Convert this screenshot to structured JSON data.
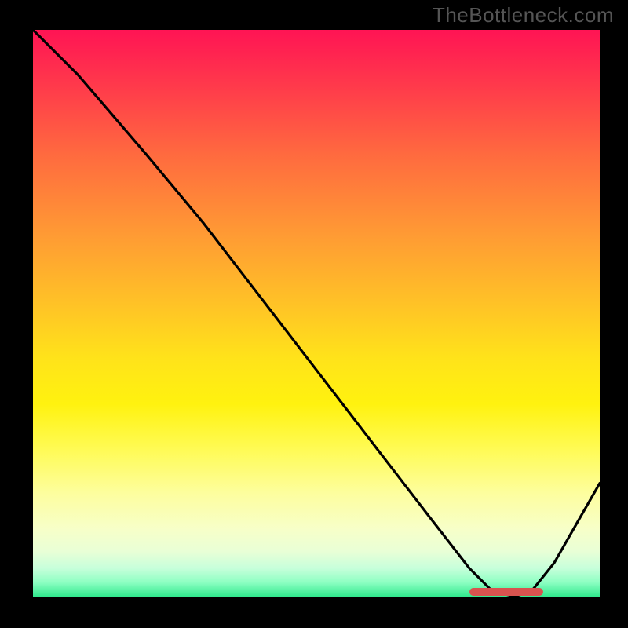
{
  "watermark": "TheBottleneck.com",
  "chart_data": {
    "type": "line",
    "title": "",
    "xlabel": "",
    "ylabel": "",
    "xlim": [
      0,
      100
    ],
    "ylim": [
      0,
      100
    ],
    "grid": false,
    "legend": false,
    "series": [
      {
        "name": "bottleneck-curve",
        "color": "#000000",
        "x": [
          0,
          8,
          20,
          30,
          40,
          50,
          60,
          70,
          77,
          81,
          85,
          88,
          92,
          96,
          100
        ],
        "values": [
          100,
          92,
          78,
          66,
          53,
          40,
          27,
          14,
          5,
          1,
          0,
          1,
          6,
          13,
          20
        ]
      }
    ],
    "flat_region": {
      "x_start": 77,
      "x_end": 90,
      "y": 0.8,
      "color": "#d9534f"
    },
    "background_gradient": {
      "direction": "vertical",
      "stops": [
        {
          "pos": 0.0,
          "color": "#ff1454"
        },
        {
          "pos": 0.36,
          "color": "#ff9a34"
        },
        {
          "pos": 0.66,
          "color": "#fff20f"
        },
        {
          "pos": 0.95,
          "color": "#c7ffdb"
        },
        {
          "pos": 1.0,
          "color": "#30e98d"
        }
      ]
    }
  }
}
